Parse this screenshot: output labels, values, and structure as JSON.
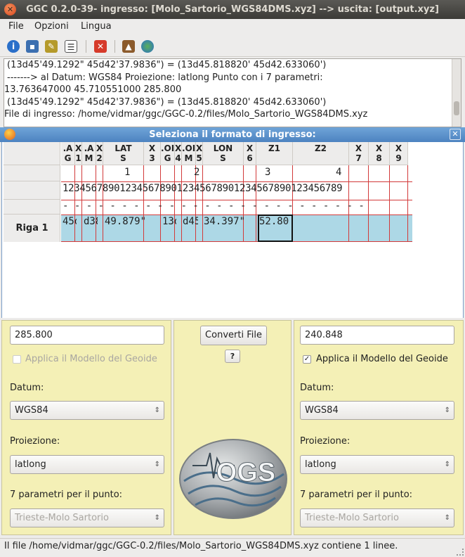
{
  "window": {
    "title": "GGC 0.2.0-39- ingresso: [Molo_Sartorio_WGS84DMS.xyz] --> uscita: [output.xyz]"
  },
  "menu": {
    "file": "File",
    "options": "Opzioni",
    "language": "Lingua"
  },
  "toolbar": {
    "icons": [
      "info-icon",
      "save-icon",
      "edit-icon",
      "table-icon",
      "close-icon",
      "map-icon",
      "globe-icon"
    ]
  },
  "log": {
    "lines": [
      " (13d45'49.1292\" 45d42'37.9836\") = (13d45.818820' 45d42.633060')",
      " -------> al  Datum: WGS84 Proiezione: latlong Punto con i 7 parametri:",
      "13.763647000 45.710551000 285.800",
      " (13d45'49.1292\" 45d42'37.9836\") = (13d45.818820' 45d42.633060')",
      "File di ingresso: /home/vidmar/ggc/GGC-0.2/files/Molo_Sartorio_WGS84DMS.xyz"
    ]
  },
  "dialog": {
    "title": "Seleziona il formato di ingresso:",
    "row_label": "Riga 1",
    "columns": [
      {
        "h1": ".A",
        "h2": "G"
      },
      {
        "h1": "X",
        "h2": "1"
      },
      {
        "h1": ".A",
        "h2": "M"
      },
      {
        "h1": "X",
        "h2": "2"
      },
      {
        "h1": "LAT",
        "h2": "S"
      },
      {
        "h1": "X",
        "h2": "3"
      },
      {
        "h1": ".OI",
        "h2": "G"
      },
      {
        "h1": "X",
        "h2": "4"
      },
      {
        "h1": ".OI",
        "h2": "M"
      },
      {
        "h1": "X",
        "h2": "5"
      },
      {
        "h1": "LON",
        "h2": "S"
      },
      {
        "h1": "X",
        "h2": "6"
      },
      {
        "h1": "Z1",
        "h2": ""
      },
      {
        "h1": "Z2",
        "h2": ""
      },
      {
        "h1": "X",
        "h2": "7"
      },
      {
        "h1": "X",
        "h2": "8"
      },
      {
        "h1": "X",
        "h2": "9"
      }
    ],
    "ruler_tens": [
      "1",
      "2",
      "3",
      "4"
    ],
    "ruler_digits": "1234567890123456789012345678901234567890123456789",
    "ruler_dashes": "- - - - - - - - - - - - - - - - - - - - - - - - - -",
    "row_values": [
      "45d",
      "d38'",
      "49.879\"",
      "13d",
      "d45'",
      "34.397\"",
      "52.80"
    ]
  },
  "left_panel": {
    "value": "285.800",
    "geoid_label": "Applica il Modello del Geoide",
    "geoid_checked": false,
    "datum_label": "Datum:",
    "datum_value": "WGS84",
    "projection_label": "Proiezione:",
    "projection_value": "latlong",
    "params_label": "7 parametri per il punto:",
    "params_value": "Trieste-Molo Sartorio"
  },
  "center_panel": {
    "convert_label": "Converti File",
    "help_label": "?",
    "logo_text": "OGS"
  },
  "right_panel": {
    "value": "240.848",
    "geoid_label": "Applica il Modello del Geoide",
    "geoid_checked": true,
    "datum_label": "Datum:",
    "datum_value": "WGS84",
    "projection_label": "Proiezione:",
    "projection_value": "latlong",
    "params_label": "7 parametri per il punto:",
    "params_value": "Trieste-Molo Sartorio"
  },
  "status": {
    "text": "Il file /home/vidmar/ggc/GGC-0.2/files/Molo_Sartorio_WGS84DMS.xyz contiene 1 linee."
  },
  "colors": {
    "panel_bg": "#f4f0b6",
    "row_highlight": "#add8e6",
    "grid_line": "#d23a3a",
    "dialog_title": "#4d83c0"
  }
}
